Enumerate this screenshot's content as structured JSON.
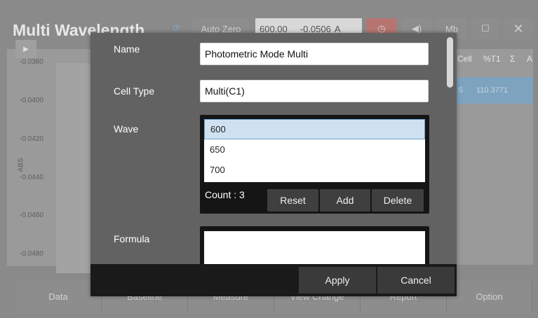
{
  "app": {
    "title": "Multi Wavelength",
    "header": {
      "sync_icon": "sync-icon",
      "auto_zero_label": "Auto Zero",
      "wavelength_value": "600.00",
      "abs_value": "-0.0506",
      "abs_unit": "A",
      "timer_icon": "timer-icon",
      "speaker_icon": "speaker-icon",
      "memory_label": "Mb",
      "edit_icon": "edit-icon",
      "close_icon": "close-icon"
    },
    "graph": {
      "ylabel": "ABS",
      "yticks": [
        "-0.0380",
        "-0.0400",
        "-0.0420",
        "-0.0440",
        "-0.0460",
        "-0.0480"
      ]
    },
    "table": {
      "headers": [
        "Cell",
        "%T1",
        "Σ",
        "A"
      ],
      "row": {
        "cell": "S",
        "t1": "110.3771"
      }
    },
    "bottom_tabs": [
      "Data",
      "Baseline",
      "Measure",
      "View Change",
      "Report",
      "Option"
    ]
  },
  "dialog": {
    "name_label": "Name",
    "name_value": "Photometric Mode Multi",
    "cell_type_label": "Cell Type",
    "cell_type_value": "Multi(C1)",
    "wave_label": "Wave",
    "wave_items": [
      "600",
      "650",
      "700"
    ],
    "count_text": "Count : 3",
    "reset_label": "Reset",
    "add_label": "Add",
    "delete_label": "Delete",
    "formula_label": "Formula",
    "formula_value": "",
    "apply_label": "Apply",
    "cancel_label": "Cancel"
  },
  "colors": {
    "selected_item_bg": "#cfe1f1",
    "selected_item_border": "#6c9fcc",
    "dialog_bg": "#626262",
    "footer_bg": "#1a1a1a"
  }
}
